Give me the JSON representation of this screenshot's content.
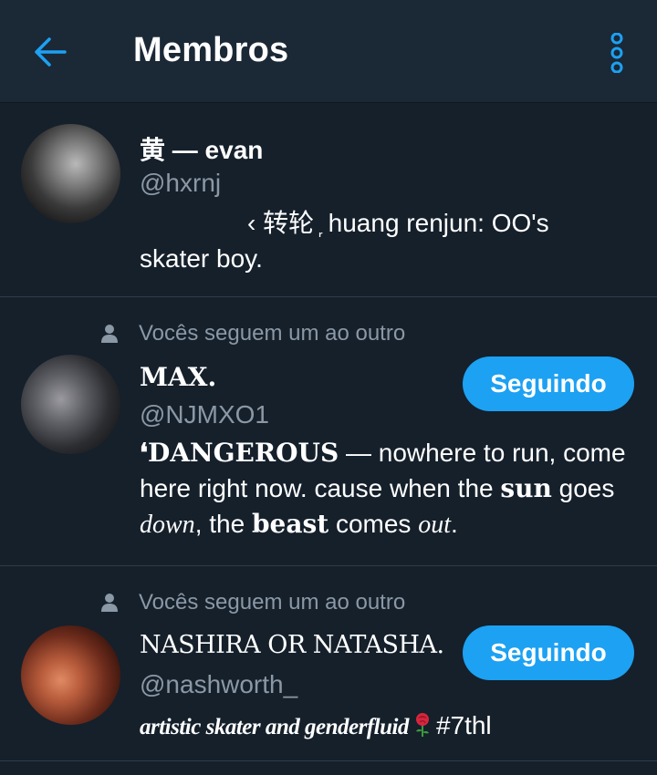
{
  "header": {
    "title": "Membros",
    "back_icon": "arrow-left-icon",
    "more_icon": "more-vertical-icon",
    "accent": "#1da1f2"
  },
  "members": [
    {
      "name": "黄 — evan",
      "handle": "@hxrnj",
      "bio_line1": "‹ 转轮 ᷊ huang renjun: OO's",
      "bio_line2": "skater boy."
    },
    {
      "social_context": "Vocês seguem um ao outro",
      "name": "MAX.",
      "handle": "@NJMXO1",
      "follow_label": "Seguindo",
      "bio_quote": "❛",
      "bio_strong": "DANGEROUS",
      "bio_a": " — nowhere to run, come here right now. cause when the ",
      "bio_sun": "sun",
      "bio_b": " goes ",
      "bio_down": "down",
      "bio_c": ", the ",
      "bio_beast": "beast",
      "bio_d": " comes ",
      "bio_out": "out",
      "bio_e": "."
    },
    {
      "social_context": "Vocês seguem um ao outro",
      "name": "NASHIRA OR NATASHA.",
      "handle": "@nashworth_",
      "follow_label": "Seguindo",
      "bio_script": "artistic skater and genderfluid",
      "bio_tag": "#7thl",
      "bio_icon": "rose-emoji-icon"
    }
  ]
}
